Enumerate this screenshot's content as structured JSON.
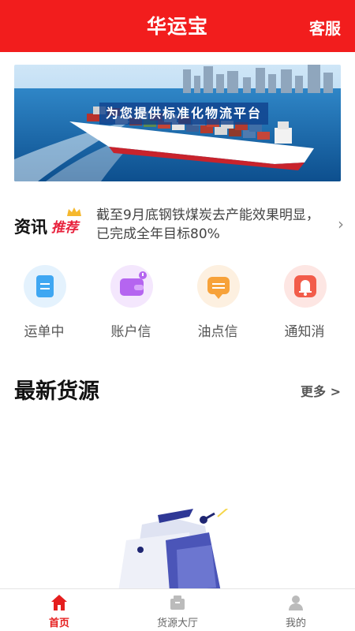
{
  "header": {
    "title": "华运宝",
    "service_label": "客服"
  },
  "banner": {
    "slogan": "为您提供标准化物流平台"
  },
  "news": {
    "logo_main": "资讯",
    "logo_sub": "推荐",
    "text": "截至9月底钢铁煤炭去产能效果明显，已完成全年目标80%"
  },
  "quick_actions": [
    {
      "label": "运单中",
      "icon": "waybill-icon",
      "color": "#3fa7f2"
    },
    {
      "label": "账户信",
      "icon": "wallet-icon",
      "color": "#b565f0"
    },
    {
      "label": "油点信",
      "icon": "message-icon",
      "color": "#f7a23a"
    },
    {
      "label": "通知消",
      "icon": "bell-icon",
      "color": "#f25c4a"
    }
  ],
  "section": {
    "title": "最新货源",
    "more": "更多 >"
  },
  "tabs": [
    {
      "label": "首页",
      "icon": "home-icon",
      "active": true
    },
    {
      "label": "货源大厅",
      "icon": "cargo-hall-icon",
      "active": false
    },
    {
      "label": "我的",
      "icon": "user-icon",
      "active": false
    }
  ],
  "colors": {
    "brand": "#f21d1d",
    "active_tab": "#e51e1e"
  }
}
